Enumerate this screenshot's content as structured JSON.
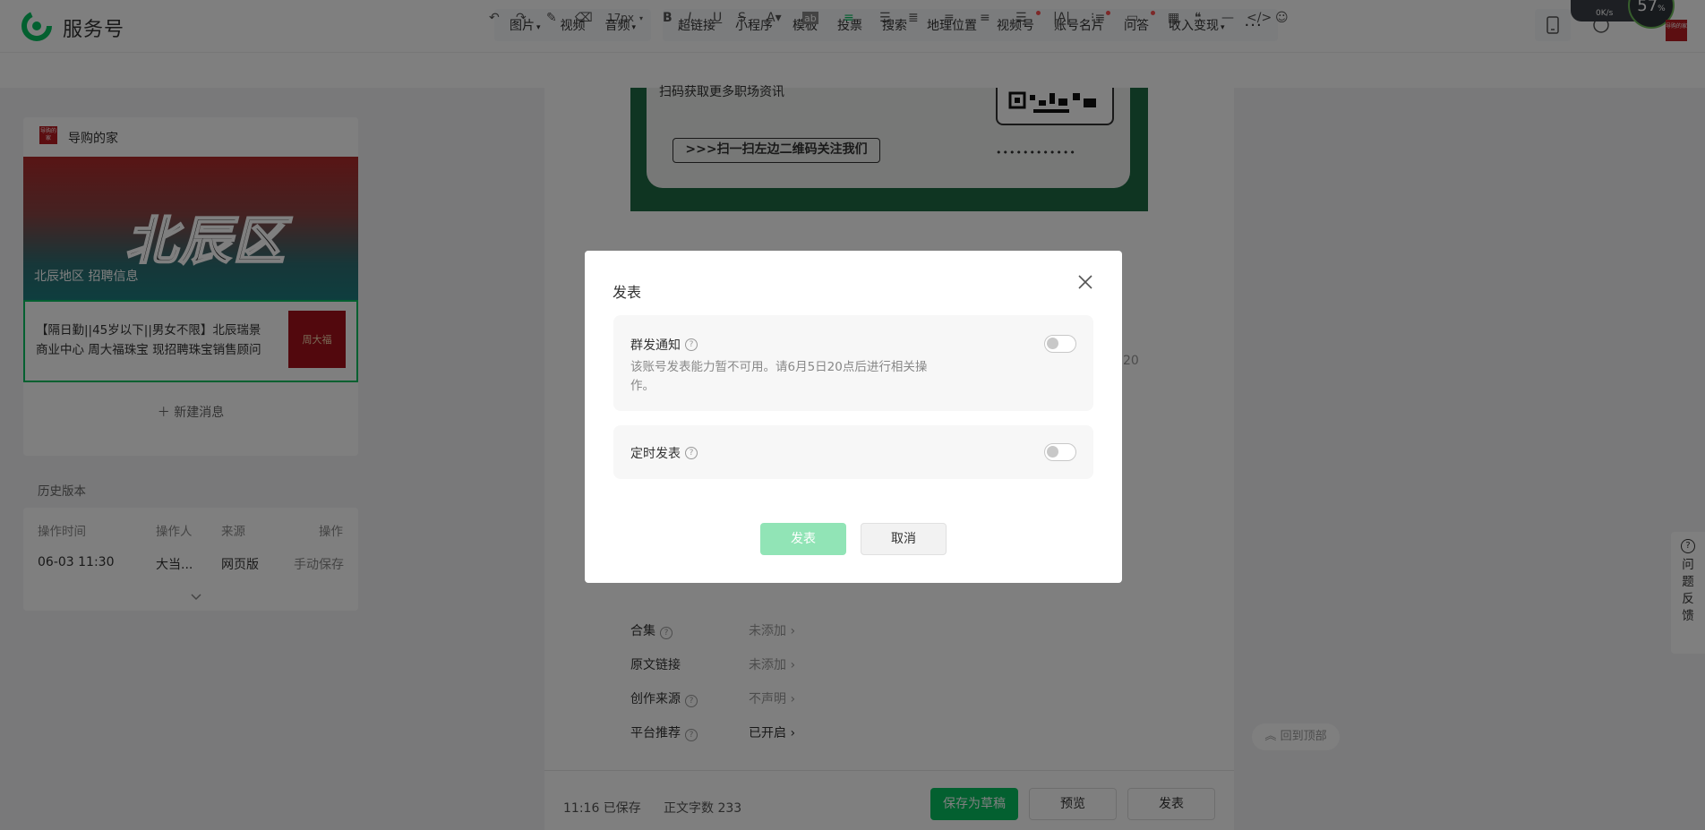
{
  "app": {
    "name": "服务号"
  },
  "topbar": {
    "group1": [
      {
        "label": "图片",
        "caret": true
      },
      {
        "label": "视频",
        "caret": false
      },
      {
        "label": "音频",
        "caret": true
      }
    ],
    "group2": [
      {
        "label": "超链接",
        "dot": false,
        "caret": false
      },
      {
        "label": "小程序",
        "dot": false,
        "caret": false
      },
      {
        "label": "模板",
        "dot": false,
        "caret": false
      },
      {
        "label": "投票",
        "dot": false,
        "caret": false
      },
      {
        "label": "搜索",
        "dot": false,
        "caret": false
      },
      {
        "label": "地理位置",
        "dot": false,
        "caret": false
      },
      {
        "label": "视频号",
        "dot": true,
        "caret": false
      },
      {
        "label": "账号名片",
        "dot": true,
        "caret": false
      },
      {
        "label": "问答",
        "dot": true,
        "caret": false
      },
      {
        "label": "收入变现",
        "dot": false,
        "caret": true
      }
    ],
    "more": "···"
  },
  "format_toolbar": {
    "font_size": "17px"
  },
  "left": {
    "account_name": "导购的家",
    "account_logo_text": "导购的家",
    "cover_big_text": "北辰区",
    "cover_sub": "北辰地区 招聘信息",
    "article_title": "【隔日勤||45岁以下||男女不限】北辰瑞景商业中心 周大福珠宝 现招聘珠宝销售顾问",
    "article_thumb_text": "周大福",
    "new_message": "新建消息",
    "history_title": "历史版本",
    "history_headers": [
      "操作时间",
      "操作人",
      "来源",
      "操作"
    ],
    "history_row": [
      "06-03 11:30",
      "大当...",
      "网页版",
      "手动保存"
    ]
  },
  "editor": {
    "qr_line": "扫码获取更多职场资讯",
    "qr_button": ">>>扫一扫左边二维码关注我们",
    "qr_dots": "••••••••••••",
    "settings": [
      {
        "label": "合集",
        "help": true,
        "value": "未添加"
      },
      {
        "label": "原文链接",
        "help": false,
        "value": "未添加"
      },
      {
        "label": "创作来源",
        "help": true,
        "value": "不声明"
      },
      {
        "label": "平台推荐",
        "help": true,
        "value": "已开启"
      }
    ],
    "partial_right_text": "20",
    "status_saved": "11:16  已保存",
    "word_count": "正文字数  233",
    "btn_save_draft": "保存为草稿",
    "btn_preview": "预览",
    "btn_publish": "发表"
  },
  "back_to_top": "回到顶部",
  "feedback": [
    "问",
    "题",
    "反",
    "馈"
  ],
  "net_widget": {
    "speed": "0K/s",
    "percent": "57",
    "percent_sign": "%"
  },
  "dialog": {
    "title": "发表",
    "option1": {
      "label": "群发通知",
      "desc": "该账号发表能力暂不可用。请6月5日20点后进行相关操作。",
      "enabled": false
    },
    "option2": {
      "label": "定时发表",
      "enabled": false
    },
    "btn_publish": "发表",
    "btn_cancel": "取消"
  },
  "colors": {
    "brand": "#07c160",
    "brand_disabled": "#91e4b6",
    "mask": "rgba(0,0,0,0.5)"
  }
}
